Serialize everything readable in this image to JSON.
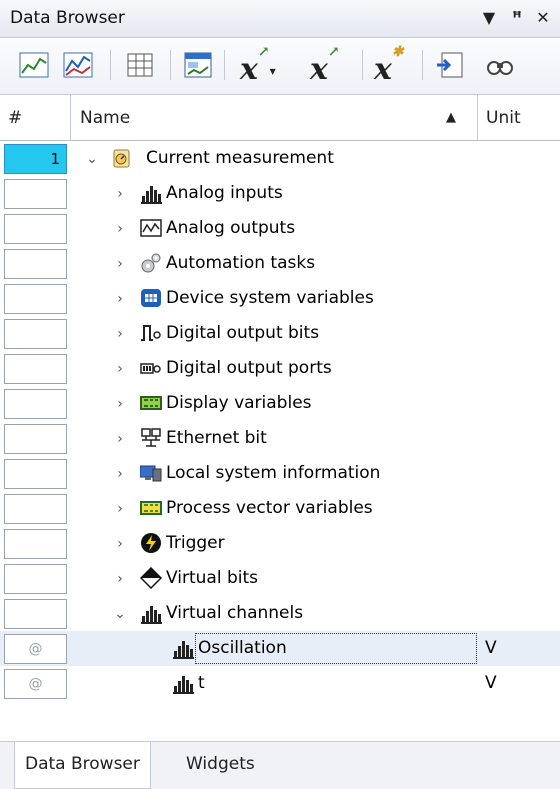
{
  "panel": {
    "title": "Data Browser",
    "controls": {
      "menu": "▼",
      "pin": "ꟸ",
      "close": "✕"
    }
  },
  "toolbar": {
    "x_labels": [
      "x",
      "x",
      "x"
    ]
  },
  "columns": {
    "num": "#",
    "name": "Name",
    "unit": "Unit",
    "sort": "▲"
  },
  "rows": [
    {
      "num": "1",
      "label": "Current measurement",
      "icon": "measurement-icon",
      "unit": ""
    },
    {
      "num": "",
      "label": "Analog inputs",
      "icon": "analog-inputs-icon",
      "unit": ""
    },
    {
      "num": "",
      "label": "Analog outputs",
      "icon": "analog-outputs-icon",
      "unit": ""
    },
    {
      "num": "",
      "label": "Automation tasks",
      "icon": "gears-icon",
      "unit": ""
    },
    {
      "num": "",
      "label": "Device system variables",
      "icon": "device-icon",
      "unit": ""
    },
    {
      "num": "",
      "label": "Digital output bits",
      "icon": "digital-bits-icon",
      "unit": ""
    },
    {
      "num": "",
      "label": "Digital output ports",
      "icon": "digital-ports-icon",
      "unit": ""
    },
    {
      "num": "",
      "label": "Display variables",
      "icon": "display-icon",
      "unit": ""
    },
    {
      "num": "",
      "label": "Ethernet bit",
      "icon": "ethernet-icon",
      "unit": ""
    },
    {
      "num": "",
      "label": "Local system information",
      "icon": "computer-icon",
      "unit": ""
    },
    {
      "num": "",
      "label": "Process vector variables",
      "icon": "vector-icon",
      "unit": ""
    },
    {
      "num": "",
      "label": "Trigger",
      "icon": "trigger-icon",
      "unit": ""
    },
    {
      "num": "",
      "label": "Virtual bits",
      "icon": "virtual-bits-icon",
      "unit": ""
    },
    {
      "num": "",
      "label": "Virtual channels",
      "icon": "channel-icon",
      "unit": ""
    },
    {
      "num": "@",
      "label": "Oscillation",
      "icon": "channel-icon",
      "unit": "V"
    },
    {
      "num": "@",
      "label": "t",
      "icon": "channel-icon",
      "unit": "V"
    }
  ],
  "tabs": [
    "Data Browser",
    "Widgets"
  ]
}
